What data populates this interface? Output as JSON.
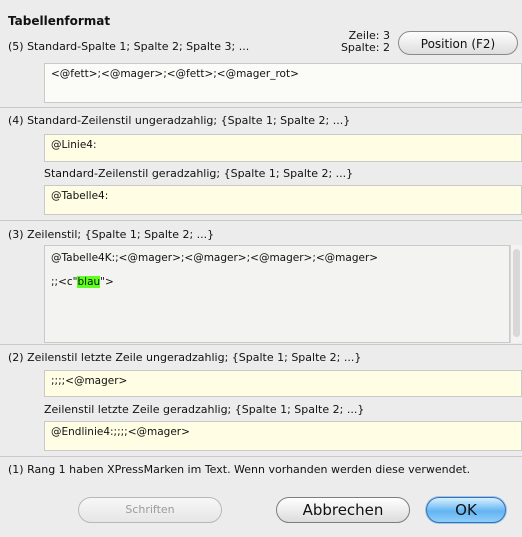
{
  "dialog": {
    "title": "Tabellenformat",
    "zeile": "Zeile: 3",
    "spalte": "Spalte: 2",
    "position_button": "Position (F2)"
  },
  "section5": {
    "label": "(5) Standard-Spalte 1; Spalte 2; Spalte 3; ...",
    "value": "<@fett>;<@mager>;<@fett>;<@mager_rot>"
  },
  "section4": {
    "label_odd": "(4) Standard-Zeilenstil ungeradzahlig; {Spalte 1; Spalte 2; ...}",
    "value_odd": "@Linie4:",
    "label_even": "Standard-Zeilenstil geradzahlig; {Spalte 1; Spalte 2; ...}",
    "value_even": "@Tabelle4:"
  },
  "section3": {
    "label": "(3) Zeilenstil; {Spalte 1; Spalte 2; ...}",
    "line1": "@Tabelle4K:;<@mager>;<@mager>;<@mager>;<@mager>",
    "line2_prefix": ";;<c\"",
    "line2_highlight": "blau",
    "line2_suffix": "\">"
  },
  "section2": {
    "label_odd": "(2) Zeilenstil letzte Zeile ungeradzahlig; {Spalte 1; Spalte 2; ...}",
    "value_odd": ";;;;<@mager>",
    "label_even": "Zeilenstil letzte Zeile geradzahlig; {Spalte 1; Spalte 2; ...}",
    "value_even": "@Endlinie4:;;;;<@mager>"
  },
  "section1": {
    "note": "(1) Rang 1 haben XPressMarken im Text. Wenn vorhanden werden diese verwendet."
  },
  "buttons": {
    "fonts": "Schriften",
    "cancel": "Abbrechen",
    "ok": "OK"
  },
  "colors": {
    "highlight": "#5cff1e",
    "field_yellow": "#fffde3",
    "default_button": "#63b4f3"
  }
}
